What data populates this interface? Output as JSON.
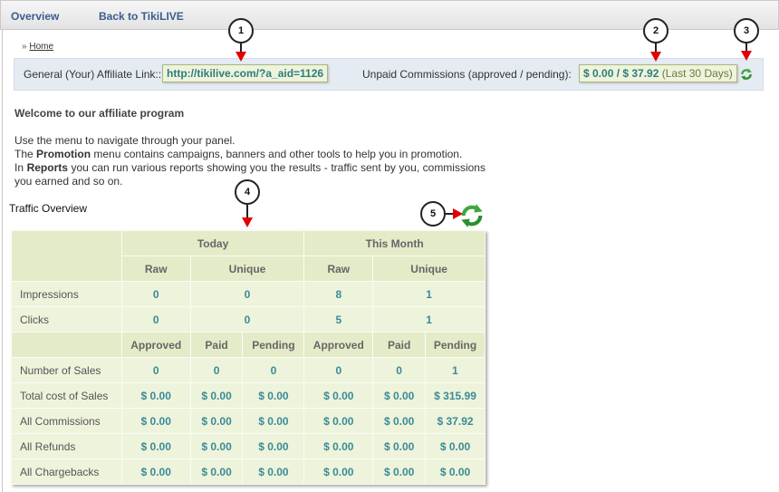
{
  "nav": {
    "overview": "Overview",
    "back": "Back to TikiLIVE"
  },
  "breadcrumb": {
    "sep": "»",
    "home": "Home"
  },
  "affiliate": {
    "link_label": "General (Your) Affiliate Link::",
    "link_value": "http://tikilive.com/?a_aid=1126",
    "commissions_label": "Unpaid Commissions (approved / pending):",
    "commissions_value": "$ 0.00 / $ 37.92",
    "commissions_period": "(Last 30 Days)"
  },
  "welcome": {
    "title": "Welcome to our affiliate program",
    "line1": "Use the menu to navigate through your panel.",
    "line2_a": "The",
    "line2_b": "Promotion",
    "line2_c": "menu contains campaigns, banners and other tools to help you in promotion.",
    "line3_a": "In",
    "line3_b": "Reports",
    "line3_c": "you can run various reports showing you the results - traffic sent by you, commissions you earned and so on."
  },
  "traffic": {
    "title": "Traffic Overview",
    "periods": [
      "Today",
      "This Month"
    ],
    "sub_raw": "Raw",
    "sub_unique": "Unique",
    "impressions": {
      "label": "Impressions",
      "values": [
        "0",
        "0",
        "8",
        "1"
      ]
    },
    "clicks": {
      "label": "Clicks",
      "values": [
        "0",
        "0",
        "5",
        "1"
      ]
    },
    "status_headers": [
      "Approved",
      "Paid",
      "Pending",
      "Approved",
      "Paid",
      "Pending"
    ],
    "rows": [
      {
        "label": "Number of Sales",
        "values": [
          "0",
          "0",
          "0",
          "0",
          "0",
          "1"
        ]
      },
      {
        "label": "Total cost of Sales",
        "values": [
          "$ 0.00",
          "$ 0.00",
          "$ 0.00",
          "$ 0.00",
          "$ 0.00",
          "$ 315.99"
        ]
      },
      {
        "label": "All Commissions",
        "values": [
          "$ 0.00",
          "$ 0.00",
          "$ 0.00",
          "$ 0.00",
          "$ 0.00",
          "$ 37.92"
        ]
      },
      {
        "label": "All Refunds",
        "values": [
          "$ 0.00",
          "$ 0.00",
          "$ 0.00",
          "$ 0.00",
          "$ 0.00",
          "$ 0.00"
        ]
      },
      {
        "label": "All Chargebacks",
        "values": [
          "$ 0.00",
          "$ 0.00",
          "$ 0.00",
          "$ 0.00",
          "$ 0.00",
          "$ 0.00"
        ]
      }
    ]
  },
  "callouts": [
    "1",
    "2",
    "3",
    "4",
    "5"
  ],
  "icons": {
    "refresh": "refresh-icon"
  },
  "colors": {
    "value_teal": "#3a8b96",
    "table_bg": "#eef3dc",
    "nav_text": "#3a5c8f",
    "arrow_red": "#e00000"
  }
}
